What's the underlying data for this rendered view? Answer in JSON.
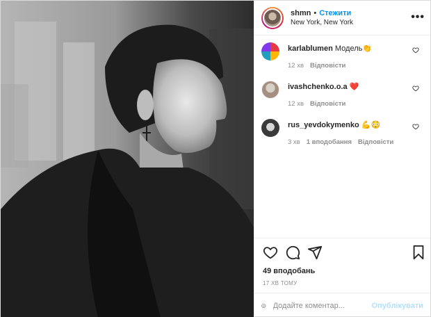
{
  "post": {
    "username": "shmn",
    "separator": "•",
    "follow_label": "Стежити",
    "location": "New York, New York",
    "more_label": "•••"
  },
  "comments": [
    {
      "username": "karlablumen",
      "text": "Модель👏",
      "time": "12 хв",
      "likes": "",
      "reply_label": "Відповісти",
      "avatar_colors": [
        "#e63946",
        "#ffb703",
        "#219ebc",
        "#8338ec"
      ]
    },
    {
      "username": "ivashchenko.o.a",
      "text": "❤️",
      "time": "12 хв",
      "likes": "",
      "reply_label": "Відповісти",
      "avatar_colors": [
        "#e9e4df",
        "#b9a697"
      ]
    },
    {
      "username": "rus_yevdokymenko",
      "text": "💪😳",
      "time": "3 хв",
      "likes": "1 вподобання",
      "reply_label": "Відповісти",
      "avatar_colors": [
        "#3a3a3a",
        "#d6d6d6"
      ]
    }
  ],
  "likes_count": "49 вподобань",
  "timestamp": "17 ХВ ТОМУ",
  "comment_box": {
    "placeholder": "Додайте коментар...",
    "publish_label": "Опублікувати"
  }
}
